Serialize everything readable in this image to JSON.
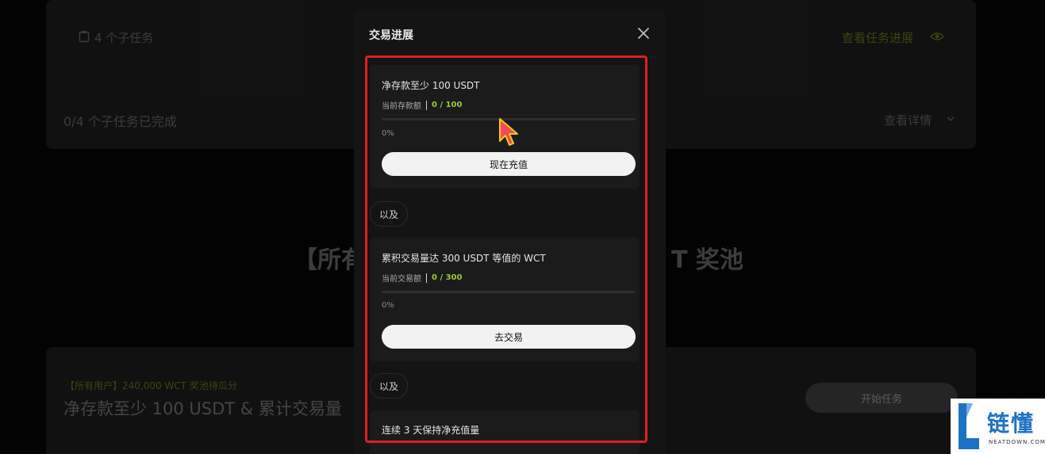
{
  "background": {
    "subtask_count": "4 个子任务",
    "view_progress": "查看任务进展",
    "completed": "0/4 个子任务已完成",
    "view_details": "查看详情",
    "headline_left": "【所有",
    "headline_right": "T 奖池",
    "pool_tag": "【所有用户】240,000 WCT 奖池待瓜分",
    "task_summary": "净存款至少 100 USDT & 累计交易量",
    "start_button": "开始任务"
  },
  "modal": {
    "title": "交易进展",
    "tasks": [
      {
        "title": "净存款至少 100 USDT",
        "meta_label": "当前存款额",
        "meta_value": "0 / 100",
        "progress": 0,
        "percent_label": "0%",
        "button": "现在充值"
      },
      {
        "title": "累积交易量达 300 USDT 等值的 WCT",
        "meta_label": "当前交易额",
        "meta_value": "0 / 300",
        "progress": 0,
        "percent_label": "0%",
        "button": "去交易"
      },
      {
        "title": "连续 3 天保持净充值量"
      }
    ],
    "connectors": [
      "以及",
      "以及"
    ]
  },
  "watermark": {
    "brand_cn": "链懂",
    "brand_en": "NEATDOWN.COM"
  },
  "colors": {
    "accent_green": "#9acd32",
    "highlight_red": "#e02020",
    "watermark_blue": "#1b72c6"
  }
}
